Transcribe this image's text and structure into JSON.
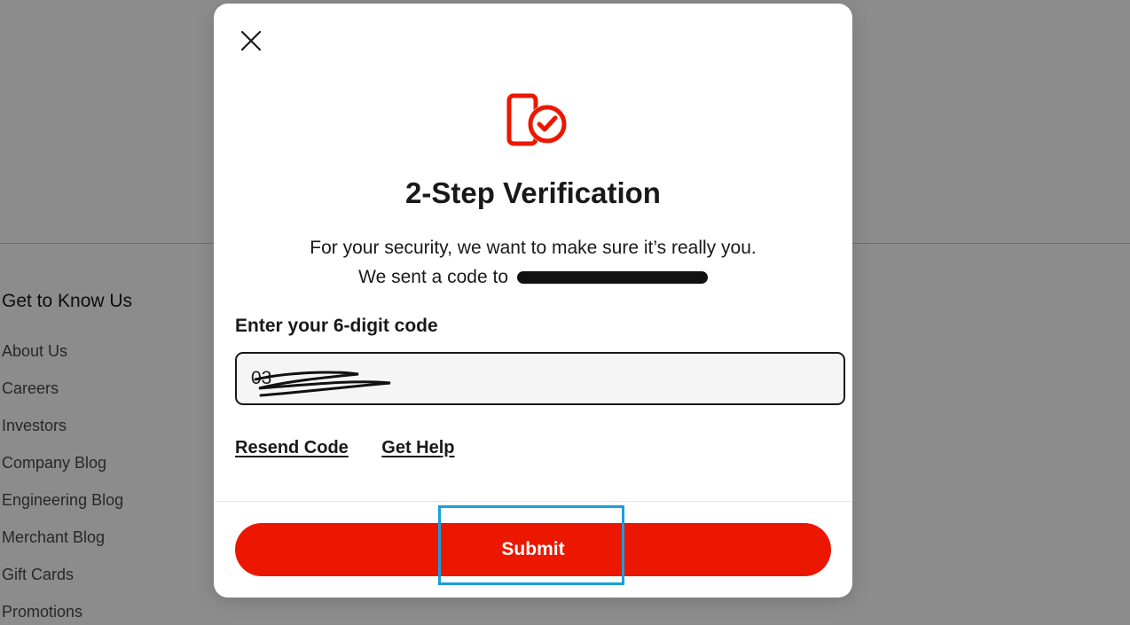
{
  "footer": {
    "heading": "Get to Know Us",
    "links": [
      "About Us",
      "Careers",
      "Investors",
      "Company Blog",
      "Engineering Blog",
      "Merchant Blog",
      "Gift Cards",
      "Promotions"
    ]
  },
  "modal": {
    "title": "2-Step Verification",
    "description_line1": "For your security, we want to make sure it’s really you.",
    "description_line2": "We sent a code to",
    "code_label": "Enter your 6-digit code",
    "code_value": "03",
    "resend_label": "Resend Code",
    "help_label": "Get Help",
    "submit_label": "Submit",
    "hero_icon": "phone-check-icon",
    "close_icon": "close-icon"
  },
  "colors": {
    "accent": "#eb1700",
    "highlight": "#1a9fdc"
  }
}
